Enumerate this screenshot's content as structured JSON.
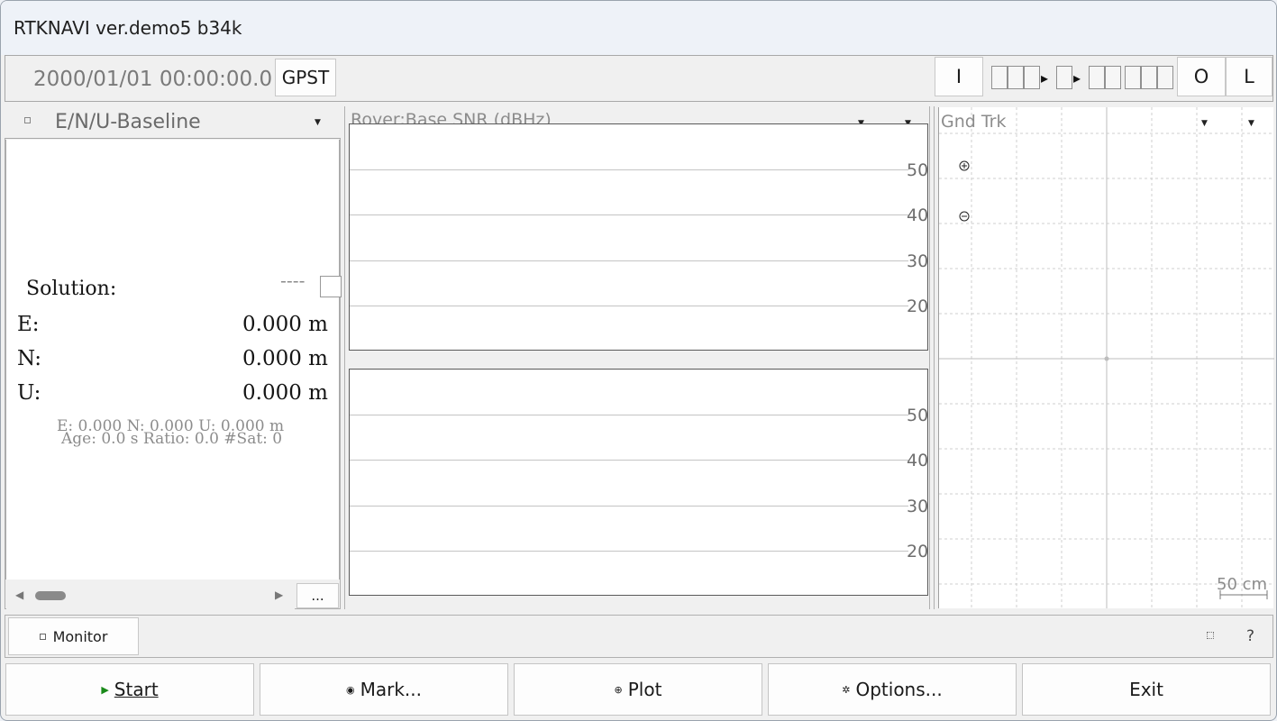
{
  "window": {
    "title": "RTKNAVI ver.demo5 b34k"
  },
  "toolbar": {
    "time": "2000/01/01 00:00:00.0",
    "time_system_button": "GPST",
    "input_button": "I",
    "output_button": "O",
    "log_button": "L"
  },
  "left_panel": {
    "view_select": "E/N/U-Baseline",
    "solution_label": "Solution:",
    "solution_status": "----",
    "rows": [
      {
        "label": "E:",
        "value": "0.000 m"
      },
      {
        "label": "N:",
        "value": "0.000 m"
      },
      {
        "label": "U:",
        "value": "0.000 m"
      }
    ],
    "std_line": "E: 0.000 N: 0.000 U: 0.000 m",
    "age_line": "Age: 0.0 s Ratio: 0.0 #Sat: 0",
    "more_button": "..."
  },
  "mid_panel": {
    "header": "Rover:Base  SNR (dBHz)",
    "y_ticks": [
      "50",
      "40",
      "30",
      "20"
    ]
  },
  "right_panel": {
    "header": "Gnd Trk",
    "scale_label": "50 cm"
  },
  "monitor": {
    "button": "Monitor",
    "help": "?"
  },
  "buttons": {
    "start": "Start",
    "mark": "Mark...",
    "plot": "Plot",
    "options": "Options...",
    "exit": "Exit"
  },
  "colors": {
    "start_icon": "#1a8a1a",
    "plot_border": "#5a5a5a",
    "grid": "#c4c4c4"
  }
}
